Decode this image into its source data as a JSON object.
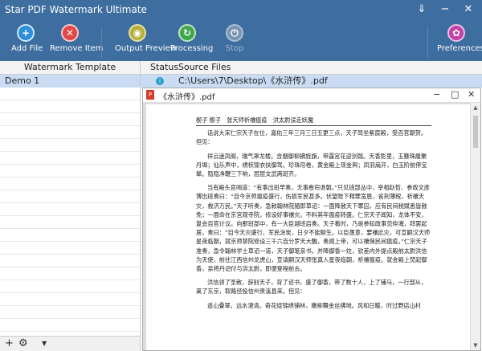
{
  "app": {
    "title": "Star PDF Watermark Ultimate"
  },
  "toolbar": {
    "add_file": "Add File",
    "remove_item": "Remove Item",
    "output_preview": "Output Preview",
    "processing": "Processing",
    "stop": "Stop",
    "preferences": "Preferences"
  },
  "left_pane": {
    "header": "Watermark Template",
    "items": [
      "Demo 1"
    ]
  },
  "right_pane": {
    "columns": {
      "status": "Status",
      "source": "Source Files"
    },
    "rows": [
      {
        "path": "C:\\Users\\7\\Desktop\\《水浒传》.pdf"
      }
    ]
  },
  "preview": {
    "title": "《水浒传》.pdf",
    "header_line": "楔子 楔子　张天师祈禳瘟疫　洪太尉误走妖魔",
    "paragraphs": [
      "话说大宋仁宗天子在位，嘉佑三年三月三日五更三点，天子驾坐紫宸殿，受百官朝贺。但见：",
      "祥云迷凤阁，瑞气罩龙楼。含烟御柳拂旌旗，带露宫花迎剑戟。天香影里，玉簪珠履聚丹墀；仙乐声中，绣袄锦衣扶御驾。珍珠帘卷，黄金殿上现金舆；凤羽扇开，白玉阶前停宝辇。隐隐净鞭三下响，层层文武两班齐。",
      "当有殿头官喝道：“有事出班早奏，无事卷帘退朝。”只见班部丛中，宰相赵哲、参政文彦博出班奏曰：“目今京师瘟疫盛行，伤损军民甚多。伏望陛下释罪宽恩，省刑薄税，祈禳天灾，救济万民。”天子听奏，急敕翰林院随即草诏：一面降赦天下罪囚，应有民间税赋悉皆赦免；一面命在京宫观寺院，修设好事禳灾。不料其年瘟疫转盛。仁宗天子闻知，龙体不安，复会百官计议。向那班部中，有一大臣越班启奏。天子看时，乃是参知政事范仲淹，拜罢起居，奏曰：“目今天灾盛行，军民涂炭，日夕不能聊生。以臣愚意，要禳此灾，可宣嗣汉天师星夜临朝，就京师禁院修设三千六百分罗天大醮，奏闻上帝，可以禳保民间瘟疫。”仁宗天子准奏，急令翰林学士草诏一道，天子御笔亲书，并降御香一炷，钦差内外提点殿前太尉洪信为天使，前往江西信州龙虎山，宣请嗣汉天师张真人星夜临朝，祈禳瘟疫。就金殿上焚起御香，亲将丹诏付与洪太尉，即便登程前去。",
      "洪信领了圣敕，辞别天子，背了诏书，盛了御香，带了数十人，上了铺马，一行部从，离了东京，取路径投信州贵溪县来。但见：",
      "遥山叠翠，远水澄清。奇花绽锦绣铺林，嫩柳舞金丝拂地。风和日暖，时过野店山村"
    ]
  }
}
